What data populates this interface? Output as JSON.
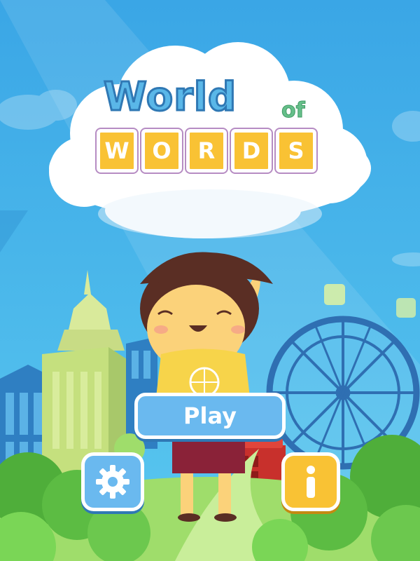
{
  "title": {
    "world": "World",
    "of": "of",
    "tiles": [
      "W",
      "O",
      "R",
      "D",
      "S"
    ]
  },
  "buttons": {
    "play": "Play",
    "settings_icon": "gear-icon",
    "info_icon": "info-icon"
  },
  "colors": {
    "sky": "#43b4ea",
    "title_blue": "#5ab7e8",
    "tile_yellow": "#f9c234",
    "button_blue": "#6ab9ef",
    "button_yellow": "#f9c234",
    "grass": "#66c24d"
  }
}
